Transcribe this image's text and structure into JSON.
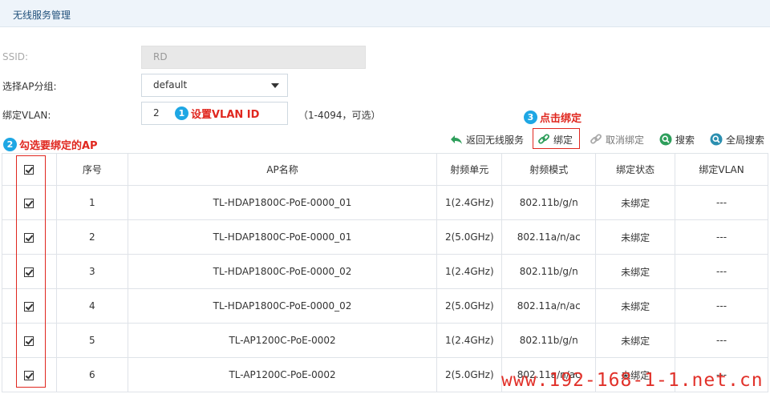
{
  "page": {
    "title": "无线服务管理"
  },
  "form": {
    "ssid_label": "SSID:",
    "ssid_value": "RD",
    "ap_group_label": "选择AP分组:",
    "ap_group_value": "default",
    "vlan_label": "绑定VLAN:",
    "vlan_value": "2",
    "vlan_hint": "（1-4094，可选）"
  },
  "annotations": {
    "a1_num": "1",
    "a1_text": "设置VLAN ID",
    "a2_num": "2",
    "a2_text": "勾选要绑定的AP",
    "a3_num": "3",
    "a3_text": "点击绑定"
  },
  "toolbar": {
    "back_label": "返回无线服务",
    "bind_label": "绑定",
    "unbind_label": "取消绑定",
    "search_label": "搜索",
    "global_search_label": "全局搜索"
  },
  "table": {
    "headers": [
      "序号",
      "AP名称",
      "射频单元",
      "射频模式",
      "绑定状态",
      "绑定VLAN"
    ],
    "rows": [
      {
        "no": "1",
        "name": "TL-HDAP1800C-PoE-0000_01",
        "radio": "1(2.4GHz)",
        "mode": "802.11b/g/n",
        "status": "未绑定",
        "vlan": "---"
      },
      {
        "no": "2",
        "name": "TL-HDAP1800C-PoE-0000_01",
        "radio": "2(5.0GHz)",
        "mode": "802.11a/n/ac",
        "status": "未绑定",
        "vlan": "---"
      },
      {
        "no": "3",
        "name": "TL-HDAP1800C-PoE-0000_02",
        "radio": "1(2.4GHz)",
        "mode": "802.11b/g/n",
        "status": "未绑定",
        "vlan": "---"
      },
      {
        "no": "4",
        "name": "TL-HDAP1800C-PoE-0000_02",
        "radio": "2(5.0GHz)",
        "mode": "802.11a/n/ac",
        "status": "未绑定",
        "vlan": "---"
      },
      {
        "no": "5",
        "name": "TL-AP1200C-PoE-0002",
        "radio": "1(2.4GHz)",
        "mode": "802.11b/g/n",
        "status": "未绑定",
        "vlan": "---"
      },
      {
        "no": "6",
        "name": "TL-AP1200C-PoE-0002",
        "radio": "2(5.0GHz)",
        "mode": "802.11a/n/ac",
        "status": "未绑定",
        "vlan": "---"
      }
    ]
  },
  "watermark": "www.192-168-1-1.net.cn",
  "colors": {
    "accent_blue": "#1ea7e4",
    "annotation_red": "#e0271f",
    "title_bg": "#eef4fa",
    "icon_green": "#2e9e5b"
  }
}
